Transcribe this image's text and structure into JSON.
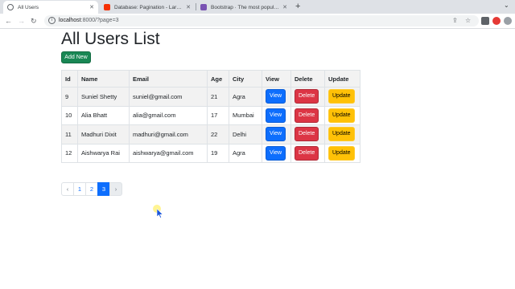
{
  "browser": {
    "tabs": [
      {
        "label": "All Users",
        "active": true,
        "favicon_color": "#5f6368"
      },
      {
        "label": "Database: Pagination - Laravel -",
        "active": false,
        "favicon_color": "#f53003"
      },
      {
        "label": "Bootstrap · The most popular HT",
        "active": false,
        "favicon_color": "#7952b3"
      }
    ],
    "new_tab_label": "+",
    "url_host": "localhost",
    "url_rest": ":8000/?page=3"
  },
  "page": {
    "title": "All Users List",
    "add_button": "Add New"
  },
  "table": {
    "headers": [
      "Id",
      "Name",
      "Email",
      "Age",
      "City",
      "View",
      "Delete",
      "Update"
    ],
    "rows": [
      {
        "id": "9",
        "name": "Suniel Shetty",
        "email": "suniel@gmail.com",
        "age": "21",
        "city": "Agra"
      },
      {
        "id": "10",
        "name": "Alia Bhatt",
        "email": "alia@gmail.com",
        "age": "17",
        "city": "Mumbai"
      },
      {
        "id": "11",
        "name": "Madhuri Dixit",
        "email": "madhuri@gmail.com",
        "age": "22",
        "city": "Delhi"
      },
      {
        "id": "12",
        "name": "Aishwarya Rai",
        "email": "aishwarya@gmail.com",
        "age": "19",
        "city": "Agra"
      }
    ],
    "view_label": "View",
    "delete_label": "Delete",
    "update_label": "Update"
  },
  "pagination": {
    "prev": "‹",
    "pages": [
      "1",
      "2",
      "3"
    ],
    "current": "3",
    "next": "›"
  },
  "colors": {
    "primary": "#0d6efd",
    "success": "#198754",
    "danger": "#dc3545",
    "warning": "#ffc107"
  }
}
